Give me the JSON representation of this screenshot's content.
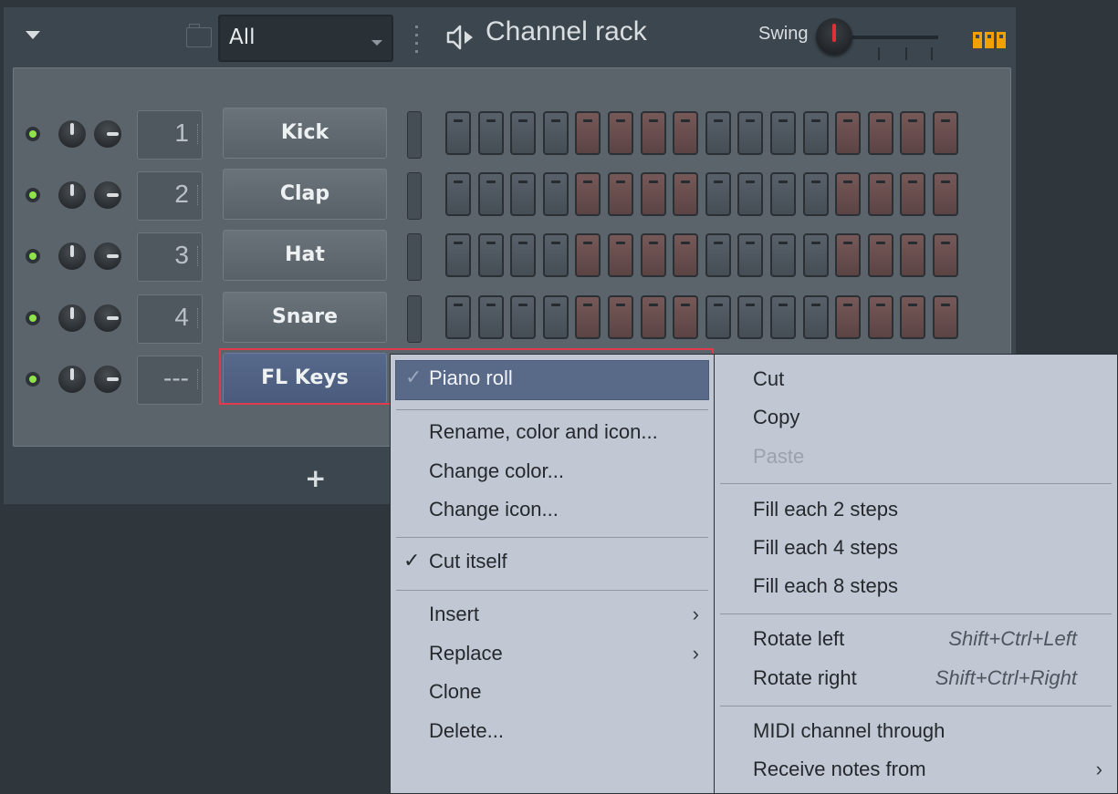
{
  "header": {
    "filter_value": "All",
    "title": "Channel rack",
    "swing_label": "Swing"
  },
  "channels": [
    {
      "number": "1",
      "name": "Kick",
      "steps_red": [
        4,
        5,
        6,
        7,
        12,
        13,
        14,
        15
      ]
    },
    {
      "number": "2",
      "name": "Clap",
      "steps_red": [
        4,
        5,
        6,
        7,
        12,
        13,
        14,
        15
      ]
    },
    {
      "number": "3",
      "name": "Hat",
      "steps_red": [
        4,
        5,
        6,
        7,
        12,
        13,
        14,
        15
      ]
    },
    {
      "number": "4",
      "name": "Snare",
      "steps_red": [
        4,
        5,
        6,
        7,
        12,
        13,
        14,
        15
      ]
    },
    {
      "number": "---",
      "name": "FL Keys",
      "selected": true
    }
  ],
  "footer": {
    "add_label": "+"
  },
  "context_menu": {
    "items": [
      {
        "label": "Piano roll",
        "checked": true,
        "highlighted": true
      },
      {
        "label": "Rename, color and icon..."
      },
      {
        "label": "Change color..."
      },
      {
        "label": "Change icon..."
      },
      {
        "label": "Cut itself",
        "checked": true
      },
      {
        "label": "Insert",
        "submenu": true
      },
      {
        "label": "Replace",
        "submenu": true
      },
      {
        "label": "Clone"
      },
      {
        "label": "Delete..."
      }
    ],
    "check_glyph": "✓",
    "submenu_glyph": "›"
  },
  "sub_menu": {
    "items": [
      {
        "label": "Cut"
      },
      {
        "label": "Copy"
      },
      {
        "label": "Paste",
        "disabled": true
      },
      {
        "label": "Fill each 2 steps"
      },
      {
        "label": "Fill each 4 steps"
      },
      {
        "label": "Fill each 8 steps"
      },
      {
        "label": "Rotate left",
        "shortcut": "Shift+Ctrl+Left"
      },
      {
        "label": "Rotate right",
        "shortcut": "Shift+Ctrl+Right"
      },
      {
        "label": "MIDI channel through"
      },
      {
        "label": "Receive notes from",
        "submenu": true
      }
    ]
  },
  "colors": {
    "panel": "#3c464e",
    "rack_body": "#5b646b",
    "menu_bg": "#c1c8d4",
    "highlight": "#596988",
    "selection_outline": "#e03a4c",
    "led_on": "#8ee44a",
    "pattern_icon": "#f2a100",
    "swing_knob_indicator": "#e0303a"
  }
}
